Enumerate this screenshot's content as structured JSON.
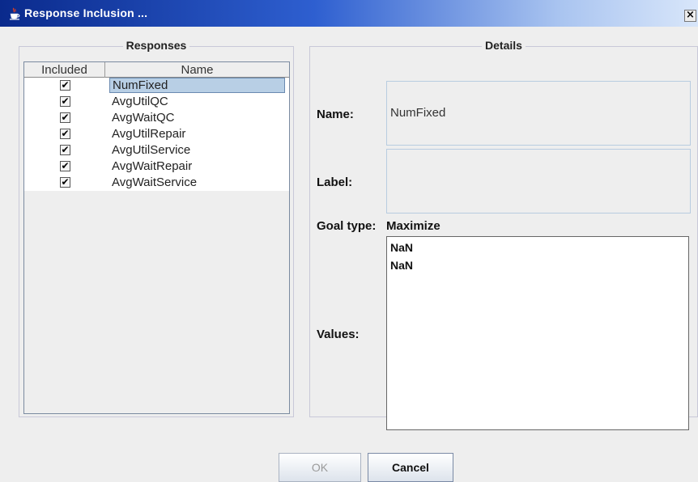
{
  "window": {
    "title": "Response Inclusion ...",
    "close_glyph": "×"
  },
  "responses": {
    "group_title": "Responses",
    "columns": {
      "included": "Included",
      "name": "Name"
    },
    "rows": [
      {
        "name": "NumFixed",
        "included": true,
        "selected": true
      },
      {
        "name": "AvgUtilQC",
        "included": true
      },
      {
        "name": "AvgWaitQC",
        "included": true
      },
      {
        "name": "AvgUtilRepair",
        "included": true
      },
      {
        "name": "AvgUtilService",
        "included": true
      },
      {
        "name": "AvgWaitRepair",
        "included": true
      },
      {
        "name": "AvgWaitService",
        "included": true
      }
    ],
    "check_glyph": "✔"
  },
  "details": {
    "group_title": "Details",
    "name_label": "Name:",
    "name_value": "NumFixed",
    "label_label": "Label:",
    "label_value": "",
    "goal_label": "Goal type:",
    "goal_value": "Maximize",
    "values_label": "Values:",
    "values": [
      "NaN",
      "NaN"
    ]
  },
  "buttons": {
    "ok": "OK",
    "cancel": "Cancel"
  },
  "colors": {
    "titlebar_start": "#0a2a8c",
    "titlebar_end": "#d8e6fa",
    "selection": "#b8cfe5",
    "background": "#eeeeee"
  },
  "icons": {
    "app": "java-cup-icon",
    "close": "close-icon",
    "checkbox": "checkbox-icon"
  }
}
